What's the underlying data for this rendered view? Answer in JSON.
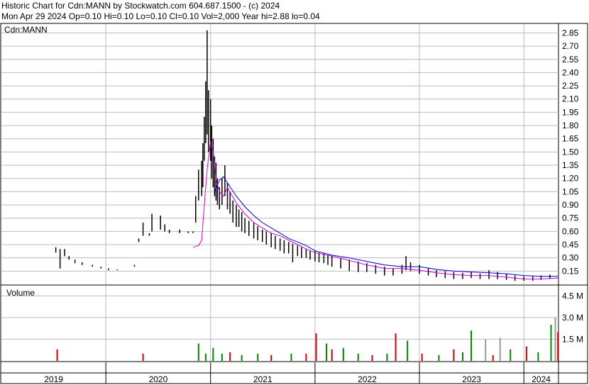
{
  "header": {
    "line1": "Historic Chart for Cdn:MANN by Stockwatch.com 604.687.1500 - (c) 2024",
    "line2": "Mon Apr 29 2024  Op=0.10  Hi=0.10  Lo=0.10  Cl=0.10  Vol=2,000  Year hi=2.88  lo=0.04"
  },
  "colors": {
    "price_bar": "#000000",
    "ma_short": "#cc00cc",
    "ma_long": "#0000cc",
    "volume_up": "#008800",
    "volume_down": "#cc0000",
    "volume_neutral": "#999999",
    "grid": "#bbbbbb"
  },
  "chart_data": [
    {
      "type": "line",
      "title": "Cdn:MANN",
      "ylim": [
        0.0,
        2.95
      ],
      "yticks": [
        0.15,
        0.3,
        0.45,
        0.6,
        0.75,
        0.9,
        1.05,
        1.2,
        1.35,
        1.5,
        1.65,
        1.8,
        1.95,
        2.1,
        2.25,
        2.4,
        2.55,
        2.7,
        2.85
      ],
      "ytick_labels": [
        "0.15",
        "0.30",
        "0.45",
        "0.60",
        "0.75",
        "0.90",
        "1.05",
        "1.20",
        "1.35",
        "1.50",
        "1.65",
        "1.80",
        "1.95",
        "2.10",
        "2.25",
        "2.40",
        "2.55",
        "2.70",
        "2.85"
      ],
      "xlim": [
        "2019-01-01",
        "2024-05-01"
      ],
      "x_year_labels": [
        "2019",
        "2020",
        "2021",
        "2022",
        "2023",
        "2024"
      ],
      "x_year_starts": [
        "2019-01-01",
        "2020-01-01",
        "2021-01-01",
        "2022-01-01",
        "2023-01-01",
        "2024-01-01"
      ],
      "series": [
        {
          "kind": "price",
          "x": [
            "2019-07-10",
            "2019-07-25",
            "2019-08-10",
            "2019-08-25",
            "2019-09-15",
            "2019-10-10",
            "2019-11-15",
            "2019-12-15",
            "2020-01-10",
            "2020-02-10",
            "2020-04-10",
            "2020-04-25",
            "2020-05-10",
            "2020-06-01",
            "2020-06-10",
            "2020-07-10",
            "2020-07-25",
            "2020-08-10",
            "2020-09-15",
            "2020-10-15",
            "2020-11-01",
            "2020-11-10",
            "2020-11-20",
            "2020-12-01",
            "2020-12-05",
            "2020-12-10",
            "2020-12-15",
            "2020-12-20",
            "2020-12-25",
            "2021-01-01",
            "2021-01-05",
            "2021-01-10",
            "2021-01-15",
            "2021-01-20",
            "2021-01-25",
            "2021-02-01",
            "2021-02-10",
            "2021-02-20",
            "2021-03-01",
            "2021-03-10",
            "2021-03-20",
            "2021-04-01",
            "2021-04-10",
            "2021-04-20",
            "2021-05-01",
            "2021-05-15",
            "2021-06-01",
            "2021-06-15",
            "2021-07-01",
            "2021-07-15",
            "2021-08-01",
            "2021-08-15",
            "2021-09-01",
            "2021-09-15",
            "2021-10-01",
            "2021-10-15",
            "2021-11-01",
            "2021-11-15",
            "2021-12-01",
            "2021-12-15",
            "2022-01-01",
            "2022-01-15",
            "2022-02-01",
            "2022-02-15",
            "2022-03-01",
            "2022-04-01",
            "2022-05-01",
            "2022-06-01",
            "2022-07-01",
            "2022-08-01",
            "2022-09-01",
            "2022-10-01",
            "2022-11-01",
            "2022-11-15",
            "2022-12-01",
            "2023-01-01",
            "2023-02-01",
            "2023-03-01",
            "2023-04-01",
            "2023-05-01",
            "2023-06-01",
            "2023-07-01",
            "2023-08-01",
            "2023-09-01",
            "2023-10-01",
            "2023-11-01",
            "2023-12-01",
            "2024-01-01",
            "2024-02-01",
            "2024-03-01",
            "2024-04-01",
            "2024-04-29"
          ],
          "high": [
            0.42,
            0.4,
            0.4,
            0.32,
            0.28,
            0.25,
            0.22,
            0.2,
            0.18,
            0.17,
            0.22,
            0.52,
            0.7,
            0.58,
            0.8,
            0.78,
            0.68,
            0.62,
            0.62,
            0.6,
            0.6,
            1.0,
            1.3,
            1.4,
            1.6,
            1.9,
            2.3,
            2.88,
            2.2,
            2.1,
            1.8,
            1.65,
            1.45,
            1.38,
            1.2,
            1.1,
            1.2,
            1.35,
            1.15,
            1.05,
            0.95,
            0.9,
            0.85,
            0.82,
            0.75,
            0.72,
            0.7,
            0.66,
            0.62,
            0.6,
            0.58,
            0.55,
            0.52,
            0.5,
            0.48,
            0.46,
            0.44,
            0.42,
            0.4,
            0.38,
            0.38,
            0.36,
            0.35,
            0.33,
            0.32,
            0.3,
            0.28,
            0.26,
            0.24,
            0.22,
            0.2,
            0.18,
            0.22,
            0.32,
            0.25,
            0.22,
            0.18,
            0.16,
            0.15,
            0.14,
            0.13,
            0.14,
            0.12,
            0.16,
            0.14,
            0.12,
            0.1,
            0.09,
            0.09,
            0.1,
            0.11,
            0.1
          ],
          "low": [
            0.36,
            0.18,
            0.32,
            0.28,
            0.24,
            0.22,
            0.2,
            0.18,
            0.16,
            0.16,
            0.2,
            0.48,
            0.55,
            0.55,
            0.6,
            0.62,
            0.6,
            0.58,
            0.58,
            0.58,
            0.58,
            0.7,
            0.95,
            1.0,
            1.1,
            1.4,
            1.6,
            1.7,
            1.5,
            1.4,
            1.2,
            1.1,
            1.0,
            0.95,
            0.9,
            0.85,
            0.9,
            1.0,
            0.85,
            0.8,
            0.7,
            0.65,
            0.65,
            0.6,
            0.58,
            0.55,
            0.52,
            0.5,
            0.48,
            0.45,
            0.42,
            0.4,
            0.38,
            0.35,
            0.35,
            0.25,
            0.32,
            0.3,
            0.3,
            0.28,
            0.26,
            0.25,
            0.24,
            0.22,
            0.2,
            0.18,
            0.15,
            0.14,
            0.14,
            0.12,
            0.1,
            0.1,
            0.12,
            0.16,
            0.15,
            0.12,
            0.1,
            0.08,
            0.07,
            0.06,
            0.06,
            0.07,
            0.06,
            0.06,
            0.06,
            0.05,
            0.04,
            0.04,
            0.04,
            0.05,
            0.06,
            0.1
          ]
        },
        {
          "kind": "ma_short",
          "x": [
            "2020-11-01",
            "2020-11-20",
            "2020-12-01",
            "2020-12-10",
            "2020-12-20",
            "2021-01-01",
            "2021-01-10",
            "2021-01-20",
            "2021-02-01",
            "2021-02-15",
            "2021-03-01",
            "2021-04-01",
            "2021-05-01",
            "2021-06-01",
            "2021-07-01",
            "2021-08-01",
            "2021-09-01",
            "2021-10-01",
            "2021-11-01",
            "2021-12-01",
            "2022-01-01",
            "2022-03-01",
            "2022-05-01",
            "2022-07-01",
            "2022-09-01",
            "2022-11-01",
            "2023-01-01",
            "2023-03-01",
            "2023-05-01",
            "2023-07-01",
            "2023-09-01",
            "2023-11-01",
            "2024-01-01",
            "2024-03-01",
            "2024-04-29"
          ],
          "y": [
            0.42,
            0.44,
            0.5,
            0.9,
            1.3,
            1.62,
            1.5,
            1.2,
            1.05,
            1.0,
            1.1,
            0.92,
            0.8,
            0.7,
            0.64,
            0.58,
            0.55,
            0.5,
            0.45,
            0.4,
            0.36,
            0.32,
            0.27,
            0.22,
            0.18,
            0.18,
            0.16,
            0.13,
            0.11,
            0.1,
            0.1,
            0.08,
            0.06,
            0.06,
            0.07
          ]
        },
        {
          "kind": "ma_long",
          "x": [
            "2021-01-15",
            "2021-02-01",
            "2021-02-15",
            "2021-03-01",
            "2021-04-01",
            "2021-05-01",
            "2021-06-01",
            "2021-07-01",
            "2021-08-01",
            "2021-09-01",
            "2021-10-01",
            "2021-11-01",
            "2021-12-01",
            "2022-01-01",
            "2022-03-01",
            "2022-05-01",
            "2022-07-01",
            "2022-09-01",
            "2022-11-01",
            "2023-01-01",
            "2023-03-01",
            "2023-05-01",
            "2023-07-01",
            "2023-09-01",
            "2023-11-01",
            "2024-01-01",
            "2024-03-01",
            "2024-04-29"
          ],
          "y": [
            1.05,
            1.18,
            1.22,
            1.15,
            1.0,
            0.88,
            0.78,
            0.7,
            0.64,
            0.58,
            0.52,
            0.48,
            0.44,
            0.38,
            0.33,
            0.3,
            0.26,
            0.22,
            0.2,
            0.2,
            0.17,
            0.15,
            0.14,
            0.13,
            0.12,
            0.1,
            0.09,
            0.09
          ]
        }
      ]
    },
    {
      "type": "bar",
      "title": "Volume",
      "ylim": [
        0,
        5.2
      ],
      "yticks": [
        1.5,
        3.0,
        4.5
      ],
      "ytick_labels": [
        "1.5 M",
        "3.0 M",
        "4.5 M"
      ],
      "unit": "M",
      "x": [
        "2019-07-15",
        "2020-05-10",
        "2020-11-20",
        "2020-12-15",
        "2021-01-10",
        "2021-02-10",
        "2021-03-10",
        "2021-04-20",
        "2021-06-15",
        "2021-08-01",
        "2021-10-10",
        "2021-12-01",
        "2022-01-05",
        "2022-02-10",
        "2022-03-01",
        "2022-04-10",
        "2022-06-01",
        "2022-07-20",
        "2022-09-10",
        "2022-10-10",
        "2022-11-20",
        "2023-01-10",
        "2023-03-10",
        "2023-05-01",
        "2023-06-01",
        "2023-07-01",
        "2023-08-20",
        "2023-09-15",
        "2023-10-10",
        "2023-11-15",
        "2024-01-10",
        "2024-02-20",
        "2024-04-05",
        "2024-04-20",
        "2024-04-29"
      ],
      "values": [
        0.8,
        0.5,
        1.2,
        0.5,
        0.9,
        0.5,
        0.6,
        0.4,
        0.5,
        0.4,
        0.5,
        0.5,
        1.9,
        1.2,
        0.8,
        0.9,
        0.5,
        0.4,
        0.5,
        1.9,
        1.4,
        0.5,
        0.4,
        0.8,
        0.6,
        2.1,
        1.5,
        0.4,
        1.6,
        0.8,
        1.0,
        0.6,
        2.5,
        3.0,
        2.0
      ],
      "direction": [
        "down",
        "down",
        "up",
        "up",
        "up",
        "up",
        "down",
        "up",
        "up",
        "down",
        "up",
        "down",
        "down",
        "up",
        "down",
        "up",
        "up",
        "down",
        "up",
        "down",
        "up",
        "down",
        "up",
        "down",
        "up",
        "up",
        "neutral",
        "down",
        "neutral",
        "up",
        "down",
        "up",
        "up",
        "neutral",
        "down"
      ]
    }
  ]
}
